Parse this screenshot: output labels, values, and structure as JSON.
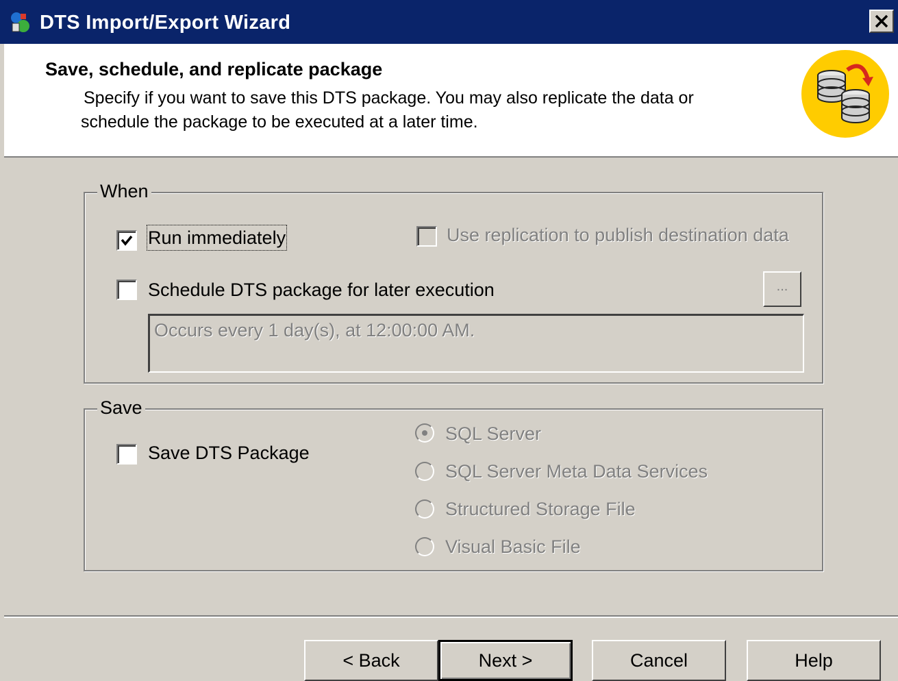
{
  "window": {
    "title": "DTS Import/Export Wizard",
    "close_glyph": "×"
  },
  "header": {
    "title": "Save, schedule, and replicate package",
    "description_line1": "Specify if you want to save this DTS package.  You may also replicate the data or",
    "description_line2": "schedule the package to be executed at a later time.",
    "icon": "database-replicate-icon"
  },
  "when": {
    "legend": "When",
    "run_immediately": {
      "label": "Run immediately",
      "checked": true
    },
    "use_replication": {
      "label": "Use replication to publish destination data",
      "checked": false,
      "disabled": true
    },
    "schedule": {
      "label": "Schedule DTS package for later execution",
      "checked": false
    },
    "ellipsis_label": "...",
    "schedule_text": "Occurs every 1 day(s), at 12:00:00 AM."
  },
  "save": {
    "legend": "Save",
    "save_package": {
      "label": "Save DTS Package",
      "checked": false
    },
    "options": [
      {
        "label": "SQL Server",
        "selected": true,
        "disabled": true
      },
      {
        "label": "SQL Server Meta Data Services",
        "selected": false,
        "disabled": true
      },
      {
        "label": "Structured Storage File",
        "selected": false,
        "disabled": true
      },
      {
        "label": "Visual Basic File",
        "selected": false,
        "disabled": true
      }
    ]
  },
  "buttons": {
    "back": "< Back",
    "next": "Next >",
    "cancel": "Cancel",
    "help": "Help"
  },
  "colors": {
    "titlebar": "#0a246a",
    "face": "#d4d0c8",
    "icon_yellow": "#ffcc00"
  }
}
